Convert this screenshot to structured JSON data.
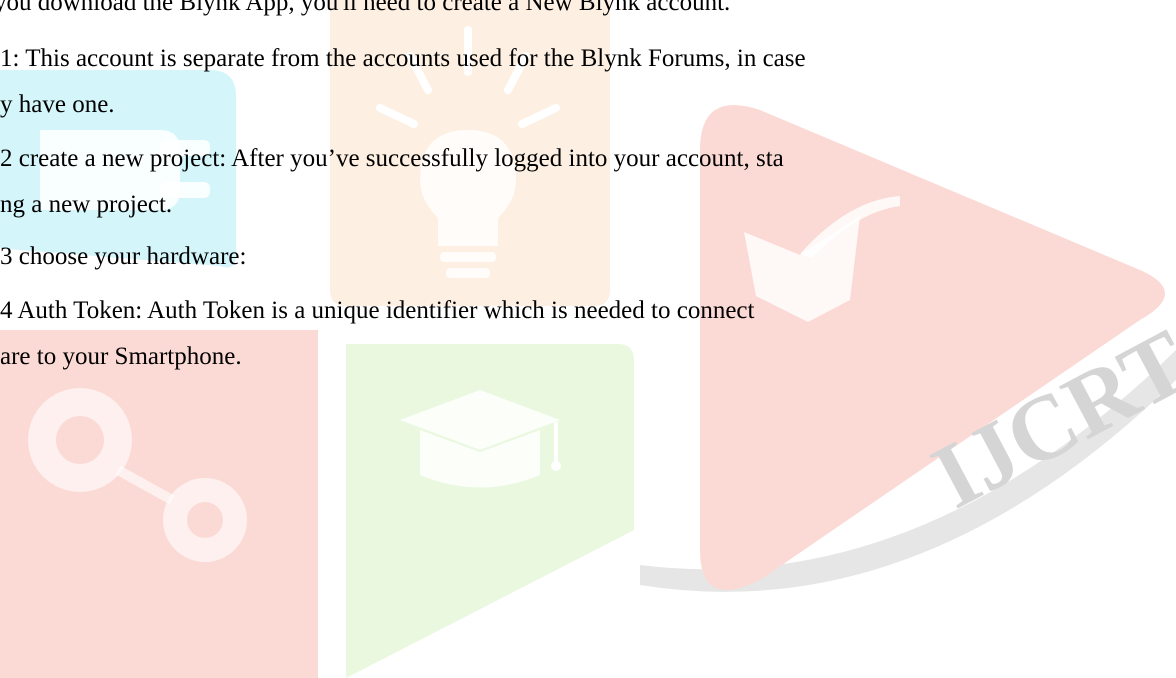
{
  "document": {
    "lines": [
      "you download the Blynk App, you'll need to create a New Blynk account.",
      "1: This account is separate from the accounts used for the Blynk Forums, in case",
      "y have one.",
      "2 create a new project: After you’ve successfully logged into your account, sta",
      "ng a new project.",
      "3 choose your hardware:",
      "4 Auth Token: Auth Token is a unique identifier which is needed to connect",
      "are to your Smartphone."
    ]
  },
  "watermark": {
    "text": "IJCRT",
    "colors": {
      "cyan": "#d4f6fb",
      "orange": "#fdf0e2",
      "red": "#fbdad5",
      "green": "#eaf8df",
      "gray": "#e6e6e6",
      "gray_dark": "#c8c8c8",
      "white": "#ffffff"
    }
  }
}
